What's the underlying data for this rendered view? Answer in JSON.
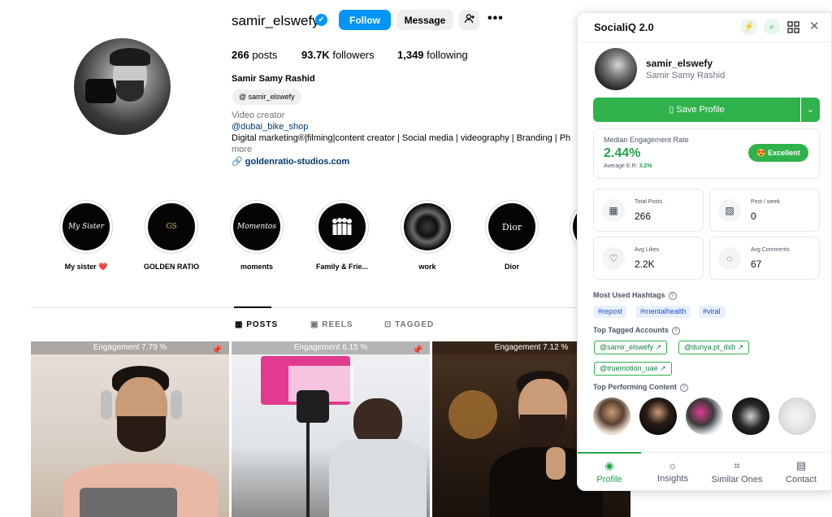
{
  "profile": {
    "username": "samir_elswefy",
    "follow_label": "Follow",
    "message_label": "Message",
    "more_label": "•••",
    "posts_count": "266",
    "posts_label": "posts",
    "followers_count": "93.7K",
    "followers_label": "followers",
    "following_count": "1,349",
    "following_label": "following",
    "full_name": "Samir Samy Rashid",
    "threads_handle": "samir_elswefy",
    "category": "Video creator",
    "mention": "@dubai_bike_shop",
    "bio_line": "Digital marketing®|filming|content creator | Social media | videography | Branding | Ph",
    "more_text": "more",
    "website": "goldenratio-studios.com"
  },
  "highlights": [
    {
      "label": "My sister ❤️",
      "cover_text": "My Sister"
    },
    {
      "label": "GOLDEN RATIO",
      "cover_text": "GS"
    },
    {
      "label": "moments",
      "cover_text": "Momentos"
    },
    {
      "label": "Family & Frie...",
      "cover_text": ""
    },
    {
      "label": "work",
      "cover_text": ""
    },
    {
      "label": "Dior",
      "cover_text": "Dior"
    }
  ],
  "tabs": {
    "posts": "POSTS",
    "reels": "REELS",
    "tagged": "TAGGED"
  },
  "posts": [
    {
      "engagement": "Engagement 7.79 %"
    },
    {
      "engagement": "Engagement 6.15 %"
    },
    {
      "engagement": "Engagement 7.12 %"
    }
  ],
  "panel": {
    "title": "SocialiQ 2.0",
    "username": "samir_elswefy",
    "full_name": "Samir Samy Rashid",
    "save_label": "Save Profile",
    "median_er_title": "Median Engagement Rate",
    "median_er_value": "2.44%",
    "avg_er_label": "Average E.R:",
    "avg_er_value": "3.2%",
    "rating": "Excellent",
    "stats": [
      {
        "label": "Total Posts",
        "value": "266",
        "icon": "calendar-icon"
      },
      {
        "label": "Post / week",
        "value": "0",
        "icon": "image-icon"
      },
      {
        "label": "Avg Likes",
        "value": "2.2K",
        "icon": "heart-icon"
      },
      {
        "label": "Avg Comments",
        "value": "67",
        "icon": "comment-icon"
      }
    ],
    "hashtags_title": "Most Used Hashtags",
    "hashtags": [
      "#repost",
      "#mentalhealth",
      "#viral"
    ],
    "tagged_title": "Top Tagged Accounts",
    "tagged": [
      "@samir_elswefy",
      "@dunya.pt_dxb",
      "@truemotion_uae"
    ],
    "top_content_title": "Top Performing Content",
    "nav": [
      {
        "label": "Profile"
      },
      {
        "label": "Insights"
      },
      {
        "label": "Similar Ones"
      },
      {
        "label": "Contact"
      }
    ],
    "colors": {
      "accent": "#2fb24c",
      "accent_text": "#22a34a",
      "hashtag_bg": "#e8f0fd",
      "instagram_blue": "#0095f6"
    }
  }
}
